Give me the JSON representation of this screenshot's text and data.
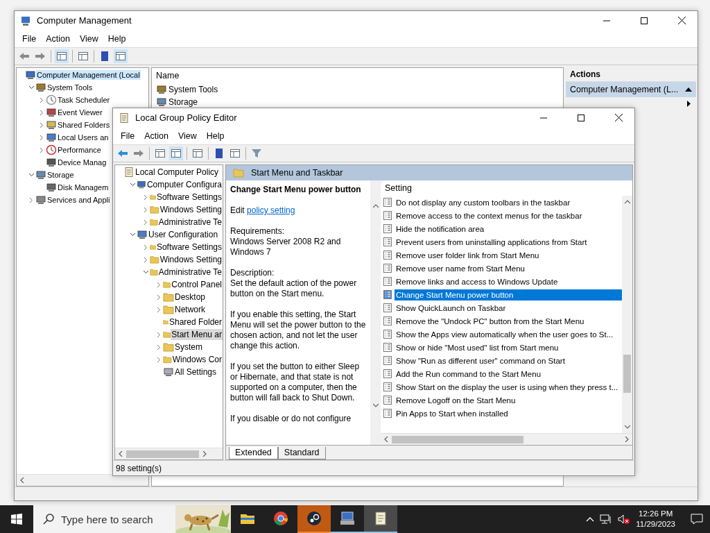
{
  "computer_management": {
    "title": "Computer Management",
    "menu": [
      "File",
      "Action",
      "View",
      "Help"
    ],
    "tree": [
      {
        "label": "Computer Management (Local",
        "kind": "computer",
        "selected": true,
        "children": [
          {
            "label": "System Tools",
            "kind": "tools",
            "expandable": true,
            "expanded": true,
            "selected": false,
            "children": [
              {
                "label": "Task Scheduler",
                "kind": "clock",
                "expandable": true,
                "expanded": false,
                "selected": false
              },
              {
                "label": "Event Viewer",
                "kind": "event",
                "expandable": true,
                "expanded": false,
                "selected": false
              },
              {
                "label": "Shared Folders",
                "kind": "share",
                "expandable": true,
                "expanded": false,
                "selected": false
              },
              {
                "label": "Local Users an",
                "kind": "users",
                "expandable": true,
                "expanded": false,
                "selected": false
              },
              {
                "label": "Performance",
                "kind": "perf",
                "expandable": true,
                "expanded": false,
                "selected": false
              },
              {
                "label": "Device Manag",
                "kind": "device",
                "selected": false
              }
            ]
          },
          {
            "label": "Storage",
            "kind": "storage",
            "expandable": true,
            "expanded": true,
            "selected": false,
            "children": [
              {
                "label": "Disk Managem",
                "kind": "disk",
                "selected": false
              }
            ]
          },
          {
            "label": "Services and Appli",
            "kind": "services",
            "expandable": true,
            "expanded": false,
            "selected": false
          }
        ]
      }
    ],
    "list_header": "Name",
    "list_items": [
      {
        "label": "System Tools",
        "kind": "tools"
      },
      {
        "label": "Storage",
        "kind": "storage"
      }
    ],
    "actions": {
      "title": "Actions",
      "section": "Computer Management (L..."
    }
  },
  "policy_editor": {
    "title": "Local Group Policy Editor",
    "menu": [
      "File",
      "Action",
      "View",
      "Help"
    ],
    "tree": [
      {
        "label": "Local Computer Policy",
        "kind": "policy",
        "selected": false,
        "children": [
          {
            "label": "Computer Configura",
            "kind": "computer",
            "expandable": true,
            "expanded": true,
            "selected": false,
            "children": [
              {
                "label": "Software Settings",
                "kind": "folder",
                "expandable": true,
                "expanded": false,
                "selected": false
              },
              {
                "label": "Windows Setting",
                "kind": "folder",
                "expandable": true,
                "expanded": false,
                "selected": false
              },
              {
                "label": "Administrative Te",
                "kind": "folder",
                "expandable": true,
                "expanded": false,
                "selected": false
              }
            ]
          },
          {
            "label": "User Configuration",
            "kind": "users",
            "expandable": true,
            "expanded": true,
            "selected": false,
            "children": [
              {
                "label": "Software Settings",
                "kind": "folder",
                "expandable": true,
                "expanded": false,
                "selected": false
              },
              {
                "label": "Windows Setting",
                "kind": "folder",
                "expandable": true,
                "expanded": false,
                "selected": false
              },
              {
                "label": "Administrative Te",
                "kind": "folder",
                "expandable": true,
                "expanded": true,
                "selected": false,
                "children": [
                  {
                    "label": "Control Panel",
                    "kind": "folder",
                    "expandable": true,
                    "expanded": false,
                    "selected": false
                  },
                  {
                    "label": "Desktop",
                    "kind": "folder",
                    "expandable": true,
                    "expanded": false,
                    "selected": false
                  },
                  {
                    "label": "Network",
                    "kind": "folder",
                    "expandable": true,
                    "expanded": false,
                    "selected": false
                  },
                  {
                    "label": "Shared Folder",
                    "kind": "folder",
                    "selected": false
                  },
                  {
                    "label": "Start Menu ar",
                    "kind": "folder",
                    "expandable": true,
                    "expanded": false,
                    "selected": true
                  },
                  {
                    "label": "System",
                    "kind": "folder",
                    "expandable": true,
                    "expanded": false,
                    "selected": false
                  },
                  {
                    "label": "Windows Cor",
                    "kind": "folder",
                    "expandable": true,
                    "expanded": false,
                    "selected": false
                  },
                  {
                    "label": "All Settings",
                    "kind": "settings",
                    "selected": false
                  }
                ]
              }
            ]
          }
        ]
      }
    ],
    "header": "Start Menu and Taskbar",
    "description": {
      "title": "Change Start Menu power button",
      "edit_prefix": "Edit",
      "edit_link": "policy setting",
      "paragraphs": [
        "Requirements:\nWindows Server 2008 R2 and Windows 7",
        "Description:\nSet the default action of the power button on the Start menu.",
        "If you enable this setting, the Start Menu will set the power button to the chosen action, and not let the user change this action.",
        "If you set the button to either Sleep or Hibernate, and that state is not supported on a computer, then the button will fall back to Shut Down.",
        "If you disable or do not configure"
      ]
    },
    "column": "Setting",
    "settings": [
      {
        "label": "Do not display any custom toolbars in the taskbar",
        "selected": false
      },
      {
        "label": "Remove access to the context menus for the taskbar",
        "selected": false
      },
      {
        "label": "Hide the notification area",
        "selected": false
      },
      {
        "label": "Prevent users from uninstalling applications from Start",
        "selected": false
      },
      {
        "label": "Remove user folder link from Start Menu",
        "selected": false
      },
      {
        "label": "Remove user name from Start Menu",
        "selected": false
      },
      {
        "label": "Remove links and access to Windows Update",
        "selected": false
      },
      {
        "label": "Change Start Menu power button",
        "selected": true
      },
      {
        "label": "Show QuickLaunch on Taskbar",
        "selected": false
      },
      {
        "label": "Remove the \"Undock PC\" button from the Start Menu",
        "selected": false
      },
      {
        "label": "Show the Apps view automatically when the user goes to St...",
        "selected": false
      },
      {
        "label": "Show or hide \"Most used\" list from Start menu",
        "selected": false
      },
      {
        "label": "Show \"Run as different user\" command on Start",
        "selected": false
      },
      {
        "label": "Add the Run command to the Start Menu",
        "selected": false
      },
      {
        "label": "Show Start on the display the user is using when they press t...",
        "selected": false
      },
      {
        "label": "Remove Logoff on the Start Menu",
        "selected": false
      },
      {
        "label": "Pin Apps to Start when installed",
        "selected": false
      }
    ],
    "tabs": [
      {
        "label": "Extended",
        "selected": true
      },
      {
        "label": "Standard",
        "selected": false
      }
    ],
    "status": "98 setting(s)"
  },
  "taskbar": {
    "search_placeholder": "Type here to search",
    "apps": [
      {
        "kind": "explorer",
        "running": false,
        "active": false,
        "attention": false
      },
      {
        "kind": "chrome",
        "running": false,
        "active": false,
        "attention": false
      },
      {
        "kind": "steam",
        "running": true,
        "active": false,
        "attention": true
      },
      {
        "kind": "management",
        "running": true,
        "active": false,
        "attention": false
      },
      {
        "kind": "policy",
        "running": true,
        "active": true,
        "attention": false
      }
    ],
    "time": "12:26 PM",
    "date": "11/29/2023"
  }
}
